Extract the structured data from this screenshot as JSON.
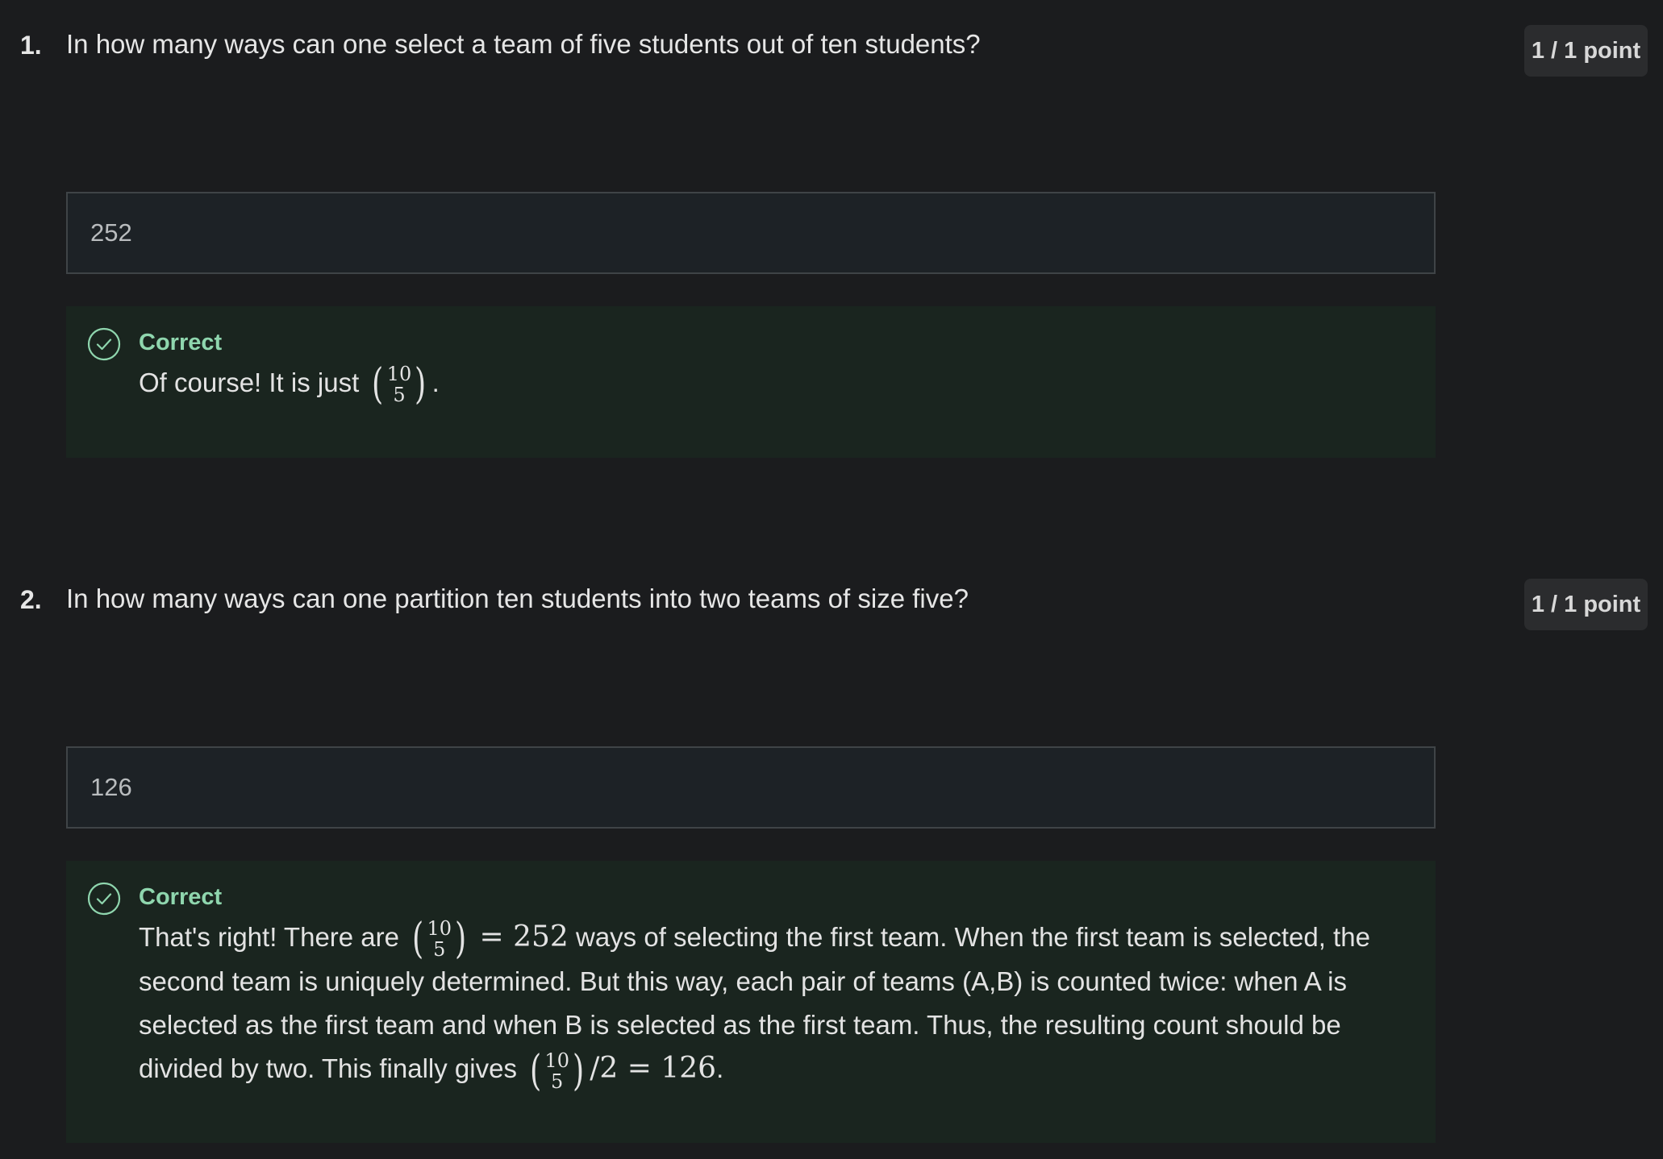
{
  "questions": [
    {
      "number": "1.",
      "text": "In how many ways can one select a team of five students out of ten students?",
      "points": "1 / 1 point",
      "answer": "252",
      "feedback": {
        "status": "Correct",
        "prefix": "Of course! It is just",
        "binom_top": "10",
        "binom_bottom": "5",
        "suffix": "."
      }
    },
    {
      "number": "2.",
      "text": "In how many ways can one partition ten students into two teams of size five?",
      "points": "1 / 1 point",
      "answer": "126",
      "feedback": {
        "status": "Correct",
        "prefix": "That's right! There are",
        "binom_top": "10",
        "binom_bottom": "5",
        "eq1": "= 252",
        "middle": "ways of selecting the first team. When the first team is selected, the second team is uniquely determined. But this way, each pair of teams (A,B) is counted twice: when A is selected as the first team and when B is selected as the first team. Thus, the resulting count should be divided by two. This finally gives",
        "binom2_top": "10",
        "binom2_bottom": "5",
        "eq2": "/2 = 126",
        "suffix": "."
      }
    }
  ],
  "colors": {
    "background": "#1b1c1e",
    "correct_accent": "#8fd6ae",
    "feedback_bg": "#1a251f",
    "answer_bg": "#1d2226"
  },
  "icons": {
    "status": "check-circle-icon"
  }
}
